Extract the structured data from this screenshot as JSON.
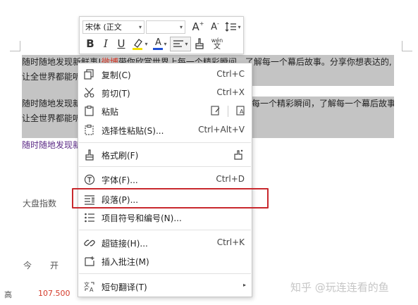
{
  "document": {
    "para1_line1_a": "随时随地发现新鲜事!",
    "para1_line1_red": "微博",
    "para1_line1_b": "带你欣赏世界上每一个精彩瞬间，了解每一个幕后故事。分享你想表达的,",
    "para1_line2": "让全世界都能听",
    "para2_line1_a": "随时随地发现新",
    "para2_line1_b": "每一个精彩瞬间，了解每一个幕后故事。分享你想表达的,",
    "para2_line2": "让全世界都能听",
    "para3": "随时随地发现新",
    "label_dapan": "大盘指数",
    "label_jin": "今开",
    "label_gao": "高",
    "value_gao": "107.500",
    "watermark": "知乎 @玩连连看的鱼"
  },
  "toolbar": {
    "font_name": "宋体 (正文",
    "grow_font": "A",
    "shrink_font": "A",
    "bold": "B",
    "italic": "I",
    "underline": "U",
    "font_color": "A",
    "pinyin": "wén"
  },
  "menu": {
    "copy": {
      "label": "复制(C)",
      "shortcut": "Ctrl+C"
    },
    "cut": {
      "label": "剪切(T)",
      "shortcut": "Ctrl+X"
    },
    "paste": {
      "label": "粘贴"
    },
    "paste_special": {
      "label": "选择性粘贴(S)...",
      "shortcut": "Ctrl+Alt+V"
    },
    "format_painter": {
      "label": "格式刷(F)"
    },
    "font": {
      "label": "字体(F)...",
      "shortcut": "Ctrl+D"
    },
    "paragraph": {
      "label": "段落(P)..."
    },
    "bullets": {
      "label": "项目符号和编号(N)..."
    },
    "hyperlink": {
      "label": "超链接(H)...",
      "shortcut": "Ctrl+K"
    },
    "comment": {
      "label": "插入批注(M)"
    },
    "translate": {
      "label": "短句翻译(T)"
    }
  },
  "colors": {
    "highlight_box": "#c8282d",
    "selection": "#c4c4c4",
    "font_color_bar": "#1f4fd6",
    "highlighter_bar": "#f4e000"
  }
}
